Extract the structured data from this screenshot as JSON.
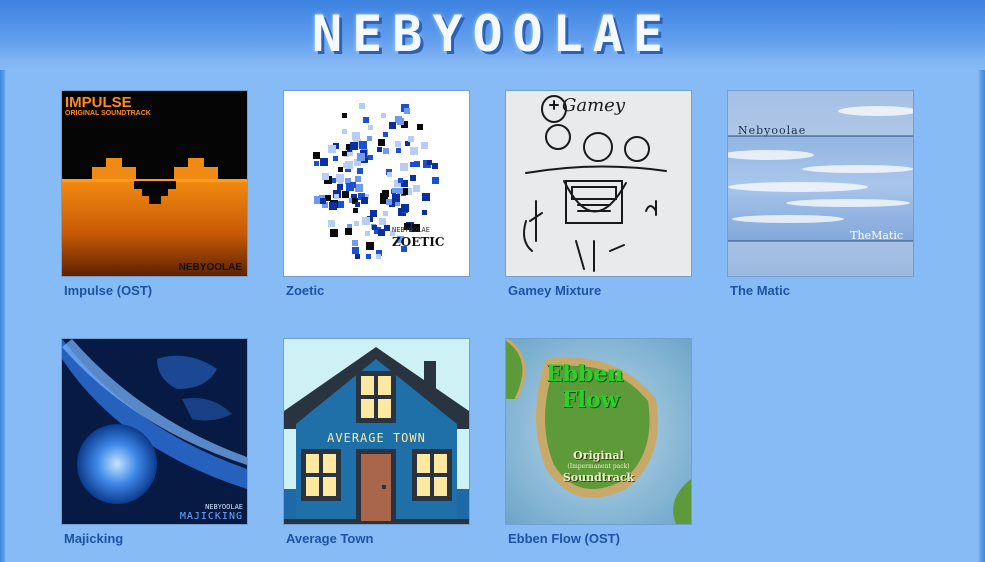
{
  "site": {
    "title": "NEBYOOLAE"
  },
  "albums": [
    {
      "title": "Impulse (OST)",
      "cover_text": {
        "heading": "IMPULSE",
        "subheading": "ORIGINAL SOUNDTRACK",
        "artist": "NEBYOOLAE"
      }
    },
    {
      "title": "Zoetic",
      "cover_text": {
        "artist": "NEBYOOLAE",
        "name": "ZOETIC"
      }
    },
    {
      "title": "Gamey Mixture",
      "cover_text": {
        "scrawl": "Gamey"
      }
    },
    {
      "title": "The Matic",
      "cover_text": {
        "artist": "Nebyoolae",
        "name": "TheMatic"
      }
    },
    {
      "title": "Majicking",
      "cover_text": {
        "artist": "NEBYOOLAE",
        "name": "MAJICKING"
      }
    },
    {
      "title": "Average Town",
      "cover_text": {
        "name": "AVERAGE TOWN"
      }
    },
    {
      "title": "Ebben Flow (OST)",
      "cover_text": {
        "line1": "Ebben",
        "line2": "Flow",
        "line3": "Original",
        "line4": "(Impermanent pack)",
        "line5": "Soundtrack"
      }
    }
  ],
  "colors": {
    "background": "#87bbf5",
    "header_blue": "#3d82e0",
    "link": "#1d53a6",
    "title_text": "#f4f8ff"
  }
}
